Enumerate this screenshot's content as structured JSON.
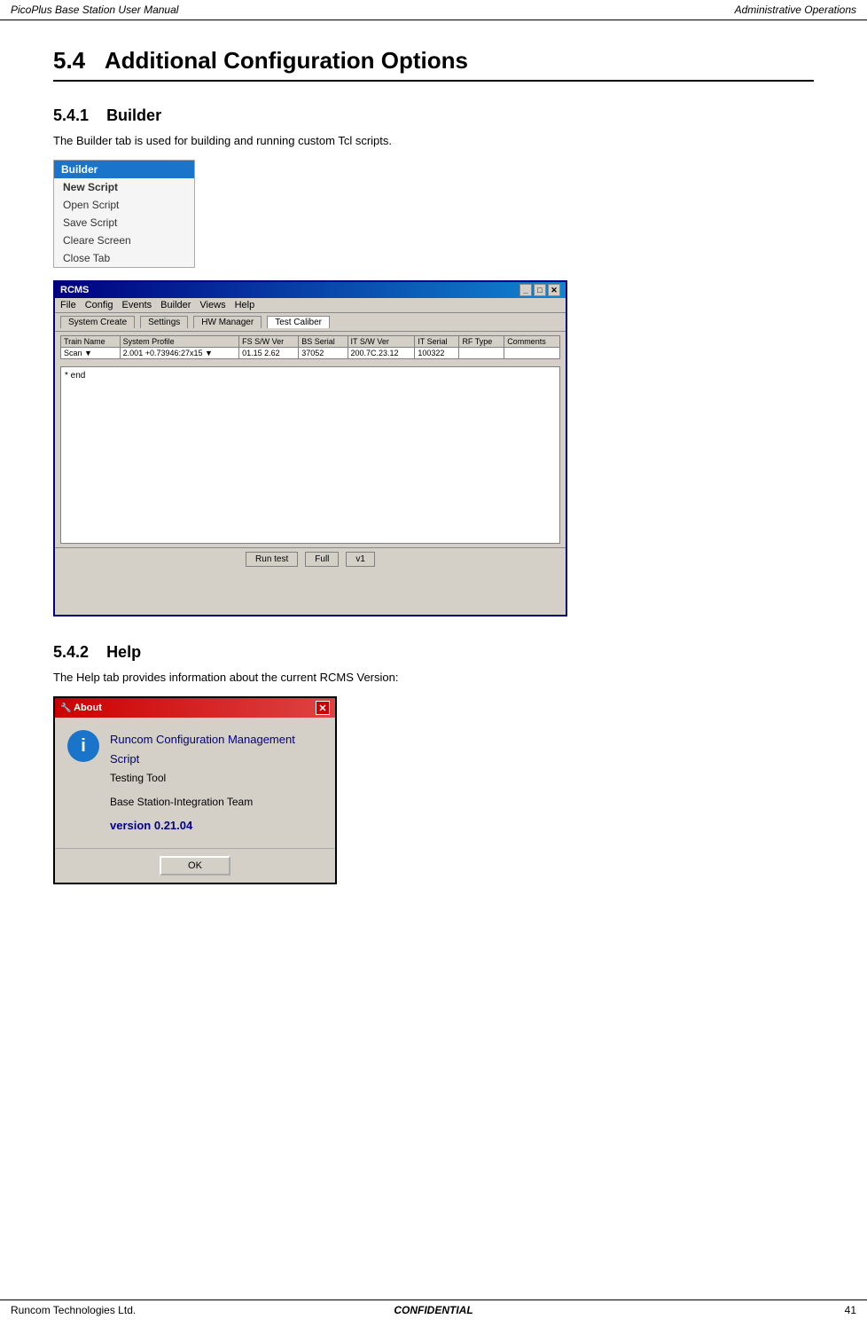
{
  "header": {
    "left": "PicoPlus Base Station User Manual",
    "right": "Administrative Operations"
  },
  "section": {
    "number": "5.4",
    "title": "Additional Configuration Options"
  },
  "subsection1": {
    "number": "5.4.1",
    "title": "Builder",
    "description": "The Builder tab is used for building and running custom Tcl scripts."
  },
  "builder_menu": {
    "header": "Builder",
    "items": [
      "New Script",
      "Open Script",
      "Save Script",
      "Cleare Screen",
      "Close Tab"
    ]
  },
  "rcms_window": {
    "title": "RCMS",
    "menubar": [
      "File",
      "Config",
      "Events",
      "Builder",
      "Views",
      "Help"
    ],
    "tabs": [
      "System Create",
      "Settings",
      "HW Manager",
      "Test Caliber"
    ],
    "table_headers": [
      "Train Name",
      "System Profile",
      "FS S/W Ver",
      "BS Serial",
      "IT S/W Ver",
      "IT Serial",
      "RF Type",
      "Comments"
    ],
    "table_row": [
      "Scan ▼",
      "2.001 +0.73946.27x15 ▼",
      "01.15  2.62",
      "37052",
      "200.7C.23.12",
      "100322",
      "",
      ""
    ],
    "content_text": "* end",
    "bottom_buttons": [
      "Run test",
      "Full",
      "v1"
    ]
  },
  "subsection2": {
    "number": "5.4.2",
    "title": "Help",
    "description": "The Help tab provides information about the current RCMS Version:"
  },
  "about_dialog": {
    "title": "About",
    "app_name": "Runcom Configuration Management Script",
    "subtitle": "Testing Tool",
    "team": "Base Station-Integration Team",
    "version": "version 0.21.04",
    "ok_button": "OK"
  },
  "footer": {
    "left": "Runcom Technologies Ltd.",
    "center": "CONFIDENTIAL",
    "right": "41"
  }
}
